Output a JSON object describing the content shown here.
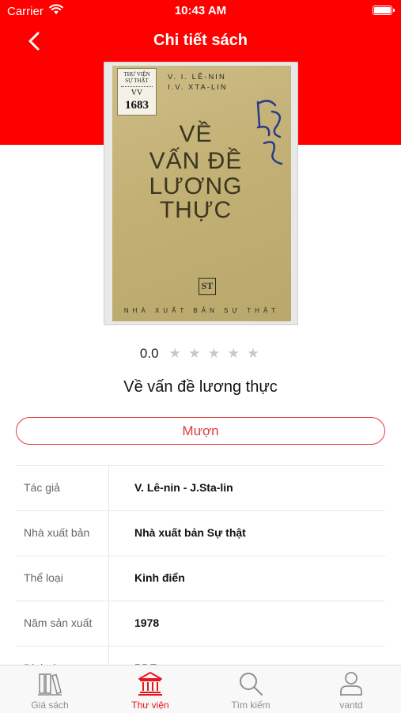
{
  "status_bar": {
    "carrier": "Carrier",
    "time": "10:43 AM",
    "icons": [
      "wifi-icon",
      "battery-icon"
    ]
  },
  "header": {
    "title": "Chi tiết sách",
    "back_icon": "chevron-left-icon",
    "background_color": "#ff0000"
  },
  "cover": {
    "stamp_line1": "THƯ VIỆN",
    "stamp_line2": "SỰ THẬT",
    "stamp_vv": "VV",
    "stamp_number": "1683",
    "author_line1": "V. I. LÊ-NIN",
    "author_line2": "I.V. XTA-LIN",
    "title_line1": "VỀ",
    "title_line2": "VẤN ĐỀ",
    "title_line3": "LƯƠNG",
    "title_line4": "THỰC",
    "logo_text": "ST",
    "publisher": "NHÀ XUẤT BẢN SỰ THẬT"
  },
  "rating": {
    "value": "0.0",
    "stars_filled": 0,
    "stars_total": 5
  },
  "book": {
    "title": "Về vấn đề lương thực"
  },
  "borrow_button": {
    "label": "Mượn",
    "color": "#e23a3a"
  },
  "details": [
    {
      "label": "Tác giả",
      "value": "V. Lê-nin - J.Sta-lin"
    },
    {
      "label": "Nhà xuất bản",
      "value": "Nhà xuất bản Sự thật"
    },
    {
      "label": "Thể loại",
      "value": "Kinh điển"
    },
    {
      "label": "Năm sản xuất",
      "value": "1978"
    },
    {
      "label": "Định dạng",
      "value": "PDF"
    }
  ],
  "tab_bar": {
    "active_color": "#e8141a",
    "items": [
      {
        "label": "Giá sách",
        "icon": "bookshelf-icon",
        "active": false
      },
      {
        "label": "Thư viện",
        "icon": "library-icon",
        "active": true
      },
      {
        "label": "Tìm kiếm",
        "icon": "search-icon",
        "active": false
      },
      {
        "label": "vantd",
        "icon": "user-icon",
        "active": false
      }
    ]
  }
}
